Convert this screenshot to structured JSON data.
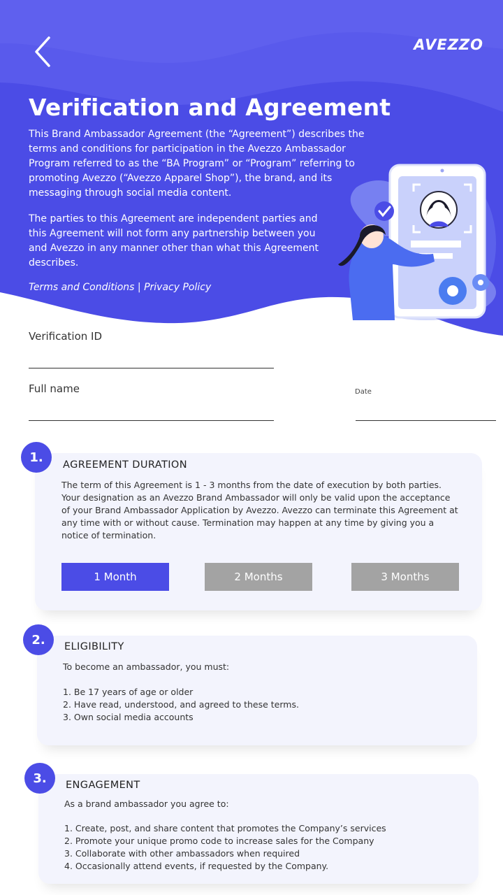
{
  "header": {
    "logo_text": "AVEZZO",
    "title": "Verification and Agreement",
    "intro_paragraph_1": "This Brand Ambassador Agreement (the “Agreement”) describes the terms and conditions for participation in the Avezzo Ambassador Program referred to as the “BA Program” or “Program” referring to promoting Avezzo (“Avezzo Apparel Shop”), the brand, and its messaging through social media content.",
    "intro_paragraph_2": "The parties to this Agreement are independent parties and this Agreement will not form any partnership between you and Avezzo in any manner other than what this Agreement describes.",
    "terms_link": "Terms and Conditions",
    "link_separator": " | ",
    "privacy_link": "Privacy Policy"
  },
  "form": {
    "verification_label": "Verification ID",
    "verification_value": "",
    "fullname_label": "Full name",
    "fullname_value": "",
    "date_label": "Date",
    "date_value": ""
  },
  "sections": {
    "duration": {
      "number": "1.",
      "title": "AGREEMENT DURATION",
      "body": "The term of this Agreement is 1 - 3 months from the date of execution by both parties. Your designation as an Avezzo Brand Ambassador will only be valid upon the acceptance of your Brand Ambassador Application by Avezzo. Avezzo can terminate this Agreement at any time with or without cause. Termination may happen at any time by giving you a notice of termination.",
      "options": [
        "1 Month",
        "2 Months",
        "3 Months"
      ],
      "selected_option": "1 Month"
    },
    "eligibility": {
      "number": "2.",
      "title": "ELIGIBILITY",
      "intro": "To become an ambassador, you must:",
      "items": [
        "1. Be 17 years of age or older",
        "2. Have read, understood, and agreed to these terms.",
        "3. Own social media accounts"
      ]
    },
    "engagement": {
      "number": "3.",
      "title": "ENGAGEMENT",
      "intro": "As a brand ambassador you agree to:",
      "items": [
        "1. Create, post, and share content that promotes the Company’s services",
        "2. Promote your unique promo code to increase sales for the Company",
        "3. Collaborate with other ambassadors when required",
        "4. Occasionally attend events, if requested by the Company."
      ]
    }
  },
  "colors": {
    "primary": "#4b4ce6",
    "hero_light": "#6364ee",
    "button_inactive": "#a3a3a3",
    "card_bg": "#f3f4fd"
  },
  "icons": {
    "back": "chevron-left-icon",
    "illustration": "face-verification-illustration"
  }
}
